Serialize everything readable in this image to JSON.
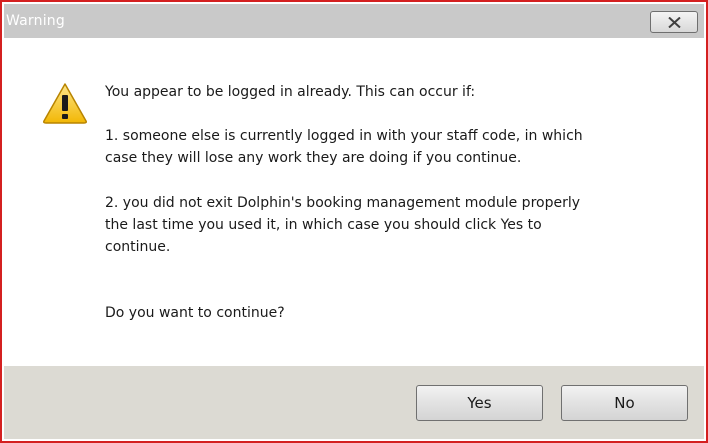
{
  "window": {
    "title": "Warning"
  },
  "message": {
    "intro": "You appear to be logged in already. This can occur if:",
    "reason_1": "1. someone else is currently logged in with your staff code, in which\ncase they will lose any work they are doing if you continue.",
    "reason_2": "2. you did not exit Dolphin's booking management module properly\nthe last time you used it, in which case you should click Yes to\ncontinue.",
    "question": "Do you want to continue?"
  },
  "buttons": {
    "yes_label": "Yes",
    "no_label": "No"
  },
  "icons": {
    "warning": "warning-icon",
    "close": "close-icon"
  },
  "colors": {
    "border": "#d42020",
    "titlebar": "#c9c9c9",
    "footer": "#dcdad3",
    "warning_yellow": "#f5c518"
  }
}
